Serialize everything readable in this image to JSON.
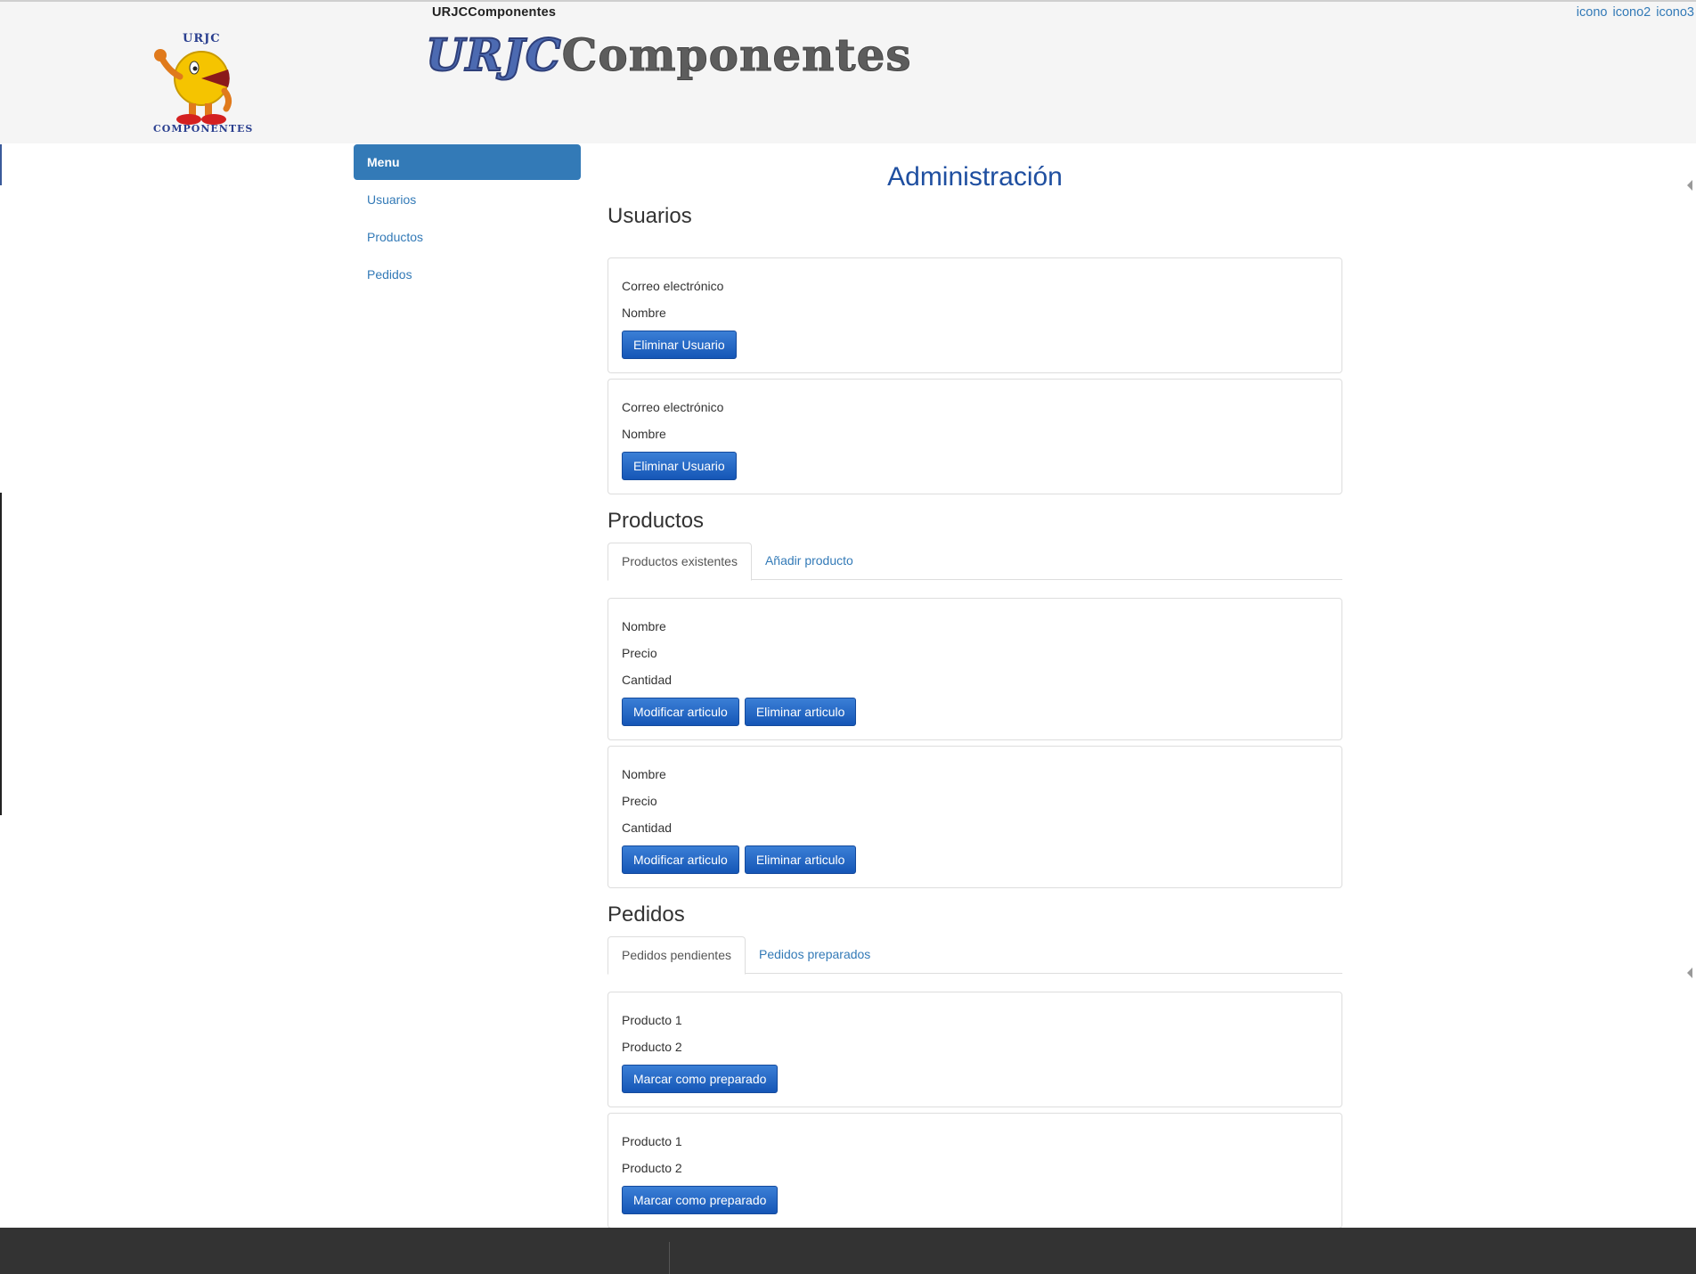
{
  "header": {
    "site_name": "URJCComponentes",
    "icons": [
      "icono",
      "icono2",
      "icono3"
    ],
    "logo_text_top": "URJC",
    "logo_text_bottom": "COMPONENTES",
    "banner_part1": "URJC",
    "banner_part2": "Componentes"
  },
  "sidebar": {
    "title": "Menu",
    "items": [
      {
        "label": "Usuarios"
      },
      {
        "label": "Productos"
      },
      {
        "label": "Pedidos"
      }
    ]
  },
  "main": {
    "title": "Administración",
    "usuarios": {
      "title": "Usuarios",
      "cards": [
        {
          "email_label": "Correo electrónico",
          "name_label": "Nombre",
          "delete_label": "Eliminar Usuario"
        },
        {
          "email_label": "Correo electrónico",
          "name_label": "Nombre",
          "delete_label": "Eliminar Usuario"
        }
      ]
    },
    "productos": {
      "title": "Productos",
      "tabs": [
        {
          "label": "Productos existentes",
          "active": true
        },
        {
          "label": "Añadir producto",
          "active": false
        }
      ],
      "cards": [
        {
          "name_label": "Nombre",
          "price_label": "Precio",
          "qty_label": "Cantidad",
          "modify_label": "Modificar articulo",
          "delete_label": "Eliminar articulo"
        },
        {
          "name_label": "Nombre",
          "price_label": "Precio",
          "qty_label": "Cantidad",
          "modify_label": "Modificar articulo",
          "delete_label": "Eliminar articulo"
        }
      ]
    },
    "pedidos": {
      "title": "Pedidos",
      "tabs": [
        {
          "label": "Pedidos pendientes",
          "active": true
        },
        {
          "label": "Pedidos preparados",
          "active": false
        }
      ],
      "cards": [
        {
          "item1": "Producto 1",
          "item2": "Producto 2",
          "mark_label": "Marcar como preparado"
        },
        {
          "item1": "Producto 1",
          "item2": "Producto 2",
          "mark_label": "Marcar como preparado"
        }
      ]
    }
  },
  "colors": {
    "accent": "#337ab7",
    "button": "#1f63c4",
    "title": "#1f4fa0",
    "footer": "#333333",
    "header_bg": "#f5f5f5"
  }
}
